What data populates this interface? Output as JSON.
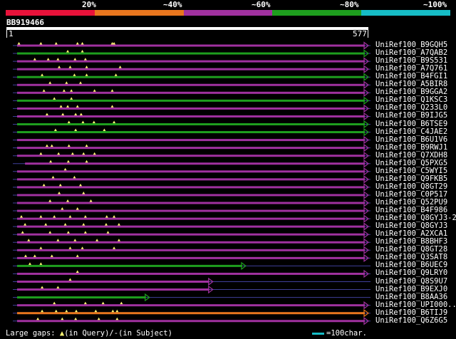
{
  "legend": {
    "segments": [
      {
        "label": "20%",
        "color": "#e8123a"
      },
      {
        "label": "~40%",
        "color": "#e8761e"
      },
      {
        "label": "~60%",
        "color": "#a0319f"
      },
      {
        "label": "~80%",
        "color": "#1e9e1e"
      },
      {
        "label": "~100%",
        "color": "#16bcc6"
      }
    ]
  },
  "query": {
    "name": "BB919466",
    "start": "1",
    "end": "577",
    "length": 577
  },
  "colors": {
    "purple": "#a0319f",
    "green": "#1e9e1e",
    "orange": "#e8761e",
    "gap_line": "#3f3f9a",
    "gap_marker": "#fff873"
  },
  "hits": [
    {
      "name": "UniRef100_B9GQH5",
      "color": "purple",
      "start": 1,
      "end": 577,
      "gaps": [
        4,
        40,
        65,
        100,
        108,
        157,
        160
      ]
    },
    {
      "name": "UniRef100_A7QAB2",
      "color": "green",
      "start": 1,
      "end": 577,
      "gaps": [
        84,
        108
      ]
    },
    {
      "name": "UniRef100_B9S531",
      "color": "purple",
      "start": 1,
      "end": 577,
      "gaps": [
        30,
        52,
        68,
        96,
        113
      ]
    },
    {
      "name": "UniRef100_A7Q761",
      "color": "purple",
      "start": 1,
      "end": 577,
      "gaps": [
        70,
        88,
        115,
        170
      ]
    },
    {
      "name": "UniRef100_B4FGI1",
      "color": "green",
      "start": 1,
      "end": 577,
      "gaps": [
        42,
        95,
        115,
        163
      ]
    },
    {
      "name": "UniRef100_A5BIR8",
      "color": "purple",
      "start": 1,
      "end": 577,
      "gaps": [
        55,
        82,
        105
      ]
    },
    {
      "name": "UniRef100_B9GGA2",
      "color": "purple",
      "start": 1,
      "end": 577,
      "gaps": [
        45,
        78,
        90,
        128,
        157
      ]
    },
    {
      "name": "UniRef100_Q1KSC3",
      "color": "green",
      "start": 1,
      "end": 577,
      "gaps": [
        62,
        90
      ]
    },
    {
      "name": "UniRef100_Q233L0",
      "color": "purple",
      "start": 1,
      "end": 577,
      "gaps": [
        73,
        84,
        100,
        157
      ]
    },
    {
      "name": "UniRef100_B9IJG5",
      "color": "purple",
      "start": 1,
      "end": 577,
      "gaps": [
        50,
        76,
        97,
        106
      ]
    },
    {
      "name": "UniRef100_B6TSE9",
      "color": "green",
      "start": 1,
      "end": 577,
      "gaps": [
        86,
        109,
        127,
        160
      ]
    },
    {
      "name": "UniRef100_C4JAE2",
      "color": "green",
      "start": 1,
      "end": 577,
      "gaps": [
        64,
        97,
        144
      ]
    },
    {
      "name": "UniRef100_B6U1V6",
      "color": "purple",
      "start": 1,
      "end": 577,
      "gaps": []
    },
    {
      "name": "UniRef100_B9RWJ1",
      "color": "purple",
      "start": 1,
      "end": 577,
      "gaps": [
        50,
        58,
        86,
        115
      ]
    },
    {
      "name": "UniRef100_Q7XDH8",
      "color": "purple",
      "start": 1,
      "end": 577,
      "gaps": [
        40,
        69,
        92,
        110,
        128
      ]
    },
    {
      "name": "UniRef100_Q5PXG5",
      "color": "purple",
      "start": 14,
      "end": 577,
      "gaps": [
        56,
        85,
        115
      ]
    },
    {
      "name": "UniRef100_C5WYI5",
      "color": "purple",
      "start": 1,
      "end": 577,
      "gaps": [
        80
      ]
    },
    {
      "name": "UniRef100_Q9FKB5",
      "color": "purple",
      "start": 1,
      "end": 577,
      "gaps": [
        60,
        95
      ]
    },
    {
      "name": "UniRef100_Q8GT29",
      "color": "purple",
      "start": 1,
      "end": 577,
      "gaps": [
        45,
        72,
        105
      ]
    },
    {
      "name": "UniRef100_C0P517",
      "color": "purple",
      "start": 1,
      "end": 577,
      "gaps": [
        70,
        110
      ]
    },
    {
      "name": "UniRef100_Q52PU9",
      "color": "purple",
      "start": 1,
      "end": 577,
      "gaps": [
        55,
        84,
        122
      ]
    },
    {
      "name": "UniRef100_B4F986",
      "color": "purple",
      "start": 1,
      "end": 577,
      "gaps": [
        75,
        100
      ]
    },
    {
      "name": "UniRef100_Q8GYJ3-2",
      "color": "purple",
      "start": 1,
      "end": 577,
      "gaps": [
        8,
        40,
        62,
        88,
        113,
        148,
        160
      ]
    },
    {
      "name": "UniRef100_Q8GYJ3",
      "color": "purple",
      "start": 1,
      "end": 577,
      "gaps": [
        14,
        48,
        80,
        110,
        147,
        168
      ]
    },
    {
      "name": "UniRef100_A2XCA1",
      "color": "purple",
      "start": 1,
      "end": 577,
      "gaps": [
        10,
        55,
        85,
        113,
        150
      ]
    },
    {
      "name": "UniRef100_B8BHF3",
      "color": "purple",
      "start": 1,
      "end": 577,
      "gaps": [
        20,
        68,
        96,
        132,
        168
      ]
    },
    {
      "name": "UniRef100_Q8GT28",
      "color": "purple",
      "start": 1,
      "end": 577,
      "gaps": [
        40,
        88,
        108,
        160
      ]
    },
    {
      "name": "UniRef100_Q3SAT8",
      "color": "purple",
      "start": 1,
      "end": 577,
      "gaps": [
        15,
        30,
        58,
        100
      ]
    },
    {
      "name": "UniRef100_B6UEC9",
      "color": "green",
      "start": 1,
      "end": 376,
      "gaps": [
        22,
        40
      ]
    },
    {
      "name": "UniRef100_Q9LRY0",
      "color": "purple",
      "start": 1,
      "end": 577,
      "gaps": [
        100
      ]
    },
    {
      "name": "UniRef100_Q8S9U7",
      "color": "purple",
      "start": 1,
      "end": 322,
      "gaps": [
        88
      ]
    },
    {
      "name": "UniRef100_B9EXJ0",
      "color": "purple",
      "start": 1,
      "end": 322,
      "gaps": [
        42,
        68
      ]
    },
    {
      "name": "UniRef100_B8AA36",
      "color": "green",
      "start": 1,
      "end": 218,
      "gaps": []
    },
    {
      "name": "UniRef100_UPI000..",
      "color": "purple",
      "start": 1,
      "end": 577,
      "gaps": [
        62,
        113,
        142,
        172
      ]
    },
    {
      "name": "UniRef100_B6TIJ9",
      "color": "orange",
      "start": 1,
      "end": 577,
      "gaps": [
        42,
        65,
        82,
        98,
        130,
        158,
        165
      ]
    },
    {
      "name": "UniRef100_Q6Z6G5",
      "color": "purple",
      "start": 1,
      "end": 577,
      "gaps": [
        35,
        75,
        97,
        135,
        165
      ]
    }
  ],
  "footer": {
    "large_gaps_prefix": "Large gaps:",
    "large_gaps_query": "(in Query)/",
    "large_gaps_dash": "-",
    "large_gaps_subject": "(in Subject)",
    "scale_label": "=100char.",
    "scale_color": "#16bcc6"
  }
}
